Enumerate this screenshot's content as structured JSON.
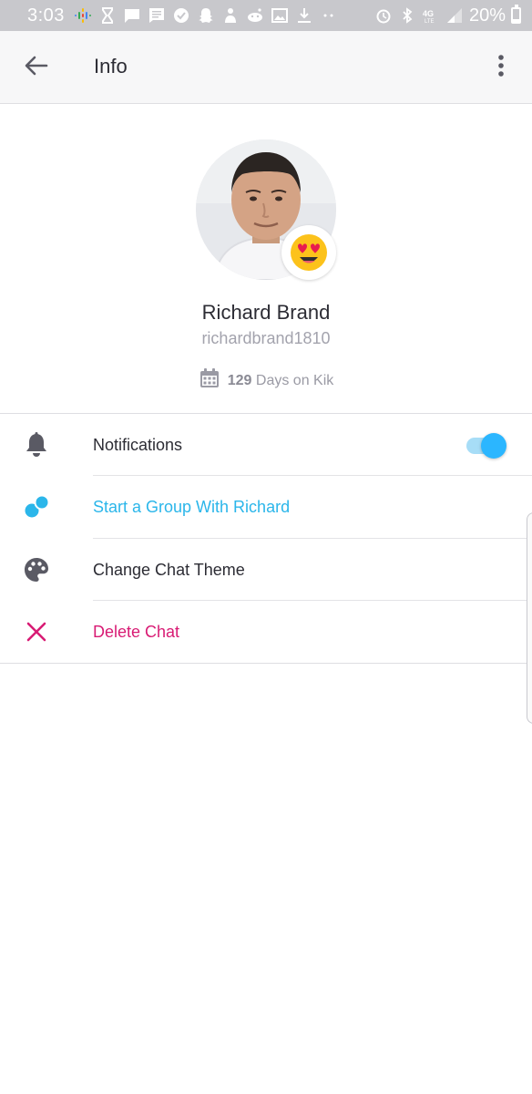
{
  "status_bar": {
    "time": "3:03",
    "battery_percent": "20%",
    "battery_level": 0.2,
    "icons": [
      "google-podcasts-icon",
      "hourglass-icon",
      "chat-bubble-icon",
      "message-icon",
      "verified-icon",
      "snapchat-icon",
      "person-icon",
      "reddit-icon",
      "image-icon",
      "download-icon",
      "dots-icon",
      "alarm-icon",
      "bluetooth-icon",
      "4g-lte-icon",
      "signal-icon",
      "battery-icon"
    ]
  },
  "app_bar": {
    "title": "Info",
    "back_icon": "back-arrow-icon",
    "more_icon": "more-vertical-icon"
  },
  "profile": {
    "display_name": "Richard Brand",
    "username": "richardbrand1810",
    "days_count": "129",
    "days_label": "Days on Kik",
    "emoji_badge": "heart-eyes-emoji"
  },
  "menu": {
    "notifications": {
      "label": "Notifications",
      "icon": "bell-icon",
      "enabled": true
    },
    "start_group": {
      "label": "Start a Group With Richard",
      "icon": "group-icon"
    },
    "change_theme": {
      "label": "Change Chat Theme",
      "icon": "palette-icon"
    },
    "delete_chat": {
      "label": "Delete Chat",
      "icon": "close-icon"
    }
  },
  "colors": {
    "accent_blue": "#2bb6ea",
    "delete_pink": "#d81b74",
    "status_bar": "#c8c8cc",
    "app_bar": "#f7f7f8"
  }
}
